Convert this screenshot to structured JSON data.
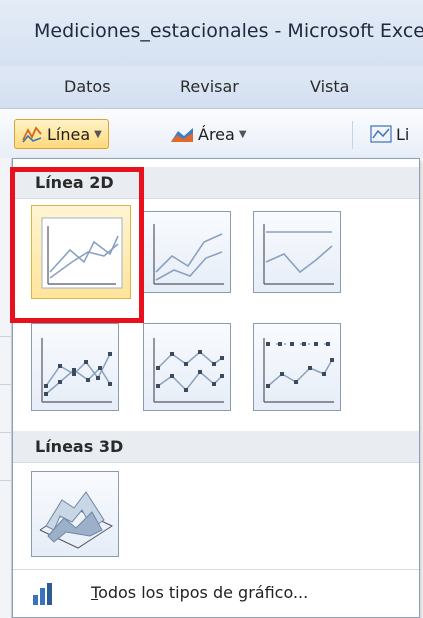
{
  "window": {
    "title": "Mediciones_estacionales - Microsoft Excel"
  },
  "ribbon_tabs": [
    {
      "label": "Datos"
    },
    {
      "label": "Revisar"
    },
    {
      "label": "Vista"
    }
  ],
  "ribbon": {
    "line_button": {
      "label": "Línea",
      "icon": "line-chart-icon"
    },
    "area_button": {
      "label": "Área",
      "icon": "area-chart-icon"
    },
    "partial_button": {
      "label": "Li",
      "icon": "line-chart-icon"
    }
  },
  "dropdown": {
    "sections": [
      {
        "title": "Línea 2D",
        "items": [
          {
            "icon": "line-chart-icon",
            "selected": true
          },
          {
            "icon": "stacked-line-chart-icon",
            "selected": false
          },
          {
            "icon": "100-stacked-line-chart-icon",
            "selected": false
          },
          {
            "icon": "line-with-markers-chart-icon",
            "selected": false
          },
          {
            "icon": "stacked-line-with-markers-chart-icon",
            "selected": false
          },
          {
            "icon": "100-stacked-line-with-markers-chart-icon",
            "selected": false
          }
        ]
      },
      {
        "title": "Líneas 3D",
        "items": [
          {
            "icon": "3d-line-chart-icon",
            "selected": false
          }
        ]
      }
    ],
    "footer": {
      "label_first": "T",
      "label_rest": "odos los tipos de gráfico...",
      "icon": "all-chart-types-icon"
    }
  },
  "colors": {
    "highlight_border": "#e8101c",
    "hover_fill": "#ffe49a",
    "accent": "#2f6fb0"
  }
}
